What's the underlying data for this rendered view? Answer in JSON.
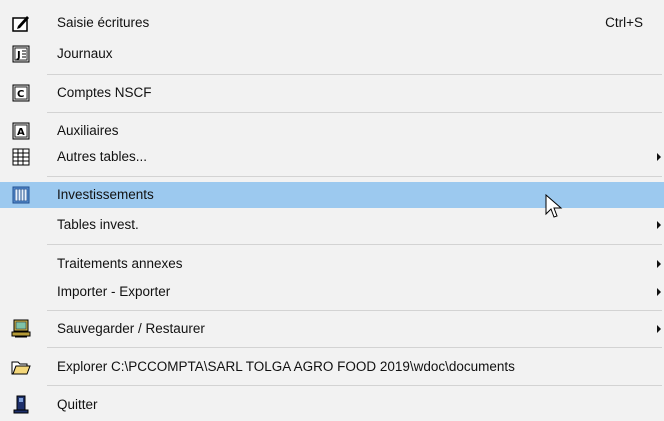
{
  "menu": {
    "items": [
      {
        "label": "Saisie écritures",
        "shortcut": "Ctrl+S",
        "icon": "edit-icon"
      },
      {
        "label": "Journaux",
        "icon": "journal-icon"
      },
      {
        "label": "Comptes NSCF",
        "icon": "accounts-icon"
      },
      {
        "label": "Auxiliaires",
        "icon": "auxiliary-icon"
      },
      {
        "label": "Autres tables...",
        "icon": "tables-icon",
        "submenu": true
      },
      {
        "label": "Investissements",
        "icon": "investments-icon",
        "highlighted": true
      },
      {
        "label": "Tables invest.",
        "submenu": true
      },
      {
        "label": "Traitements annexes",
        "submenu": true
      },
      {
        "label": "Importer - Exporter",
        "submenu": true
      },
      {
        "label": "Sauvegarder / Restaurer",
        "icon": "backup-computer-icon",
        "submenu": true
      },
      {
        "label": "Explorer C:\\PCCOMPTA\\SARL TOLGA AGRO FOOD 2019\\wdoc\\documents",
        "icon": "open-folder-icon"
      },
      {
        "label": "Quitter",
        "icon": "exit-icon"
      }
    ]
  },
  "colors": {
    "menu_background": "#f2f2f2",
    "highlight": "#9cc9ef",
    "separator": "#d3d3d3"
  }
}
